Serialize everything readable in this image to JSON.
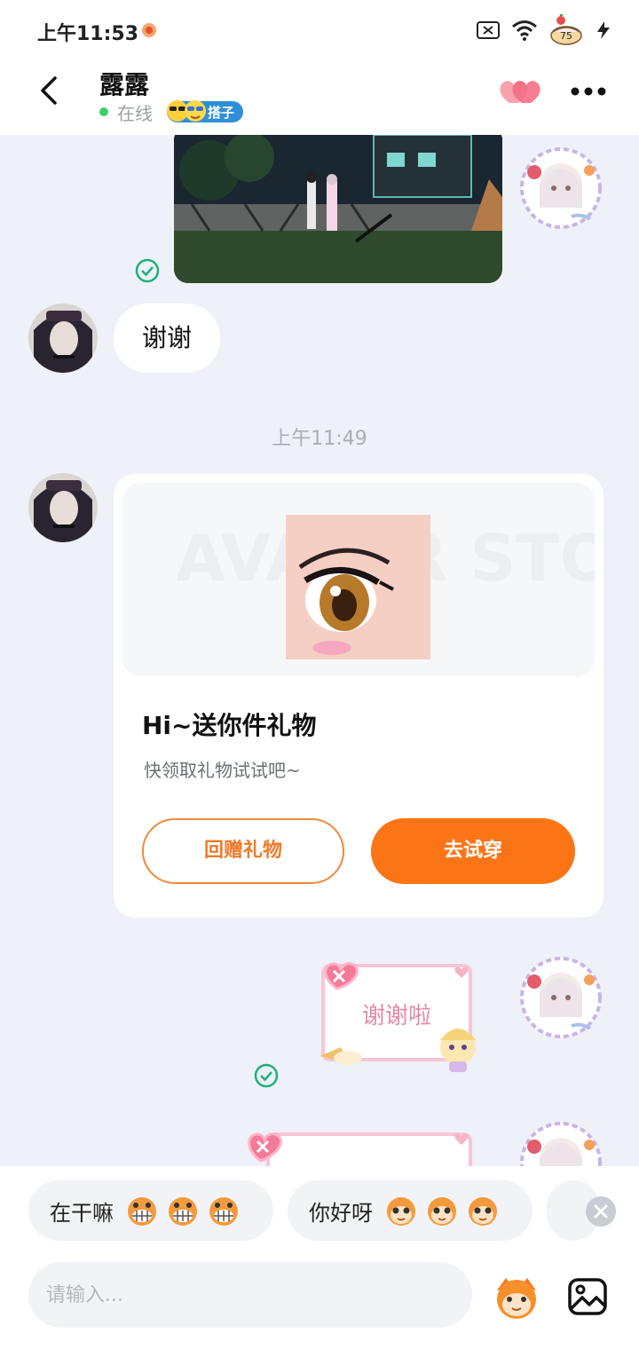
{
  "status_bar": {
    "time": "上午11:53",
    "battery": "75",
    "icons": [
      "app-notification-icon",
      "sim-off-icon",
      "wifi-icon",
      "battery-icon",
      "charging-icon"
    ]
  },
  "header": {
    "contact_name": "露露",
    "online_status": "在线",
    "relation_badge": "搭子",
    "icons": [
      "back-icon",
      "heart-icon",
      "more-icon"
    ],
    "accent_color": "#fb7517"
  },
  "chat": {
    "messages": [
      {
        "type": "video",
        "side": "outgoing",
        "read": true
      },
      {
        "type": "text",
        "side": "incoming",
        "text": "谢谢"
      },
      {
        "type": "timestamp",
        "text": "上午11:49"
      },
      {
        "type": "gift",
        "side": "incoming",
        "title": "Hi~送你件礼物",
        "subtitle": "快领取礼物试试吧~",
        "banner_watermark": "AVATAR STORE",
        "return_button": "回赠礼物",
        "try_button": "去试穿"
      },
      {
        "type": "sticker",
        "side": "outgoing",
        "text": "谢谢啦",
        "read": true
      },
      {
        "type": "sticker",
        "side": "outgoing",
        "text": ""
      }
    ]
  },
  "quick_replies": [
    {
      "text": "在干嘛",
      "emoji": "grin-face-icon"
    },
    {
      "text": "你好呀",
      "emoji": "cute-face-icon"
    }
  ],
  "composer": {
    "placeholder": "请输入...",
    "icons": [
      "mascot-emoji-icon",
      "gallery-icon"
    ]
  }
}
